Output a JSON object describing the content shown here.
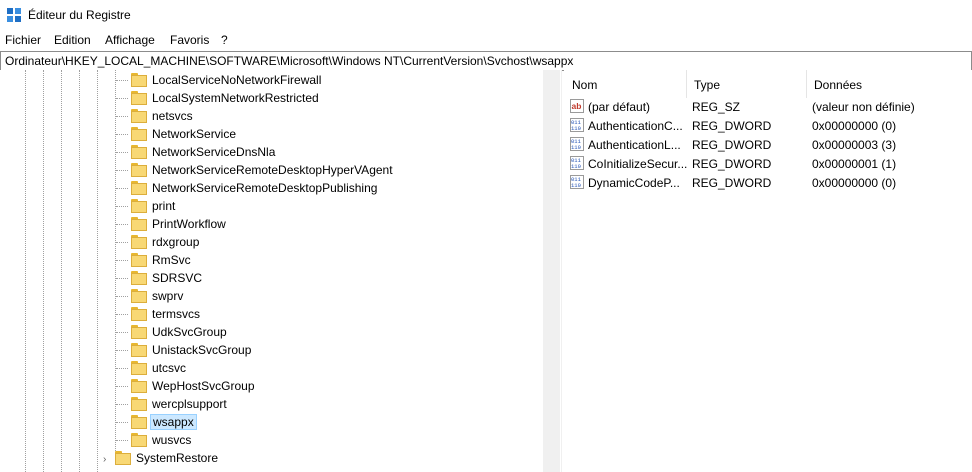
{
  "window": {
    "title": "Éditeur du Registre"
  },
  "menu": [
    "Fichier",
    "Edition",
    "Affichage",
    "Favoris",
    "?"
  ],
  "address": "Ordinateur\\HKEY_LOCAL_MACHINE\\SOFTWARE\\Microsoft\\Windows NT\\CurrentVersion\\Svchost\\wsappx",
  "tree": {
    "items": [
      {
        "label": "LocalServiceNoNetworkFirewall"
      },
      {
        "label": "LocalSystemNetworkRestricted"
      },
      {
        "label": "netsvcs"
      },
      {
        "label": "NetworkService"
      },
      {
        "label": "NetworkServiceDnsNla"
      },
      {
        "label": "NetworkServiceRemoteDesktopHyperVAgent"
      },
      {
        "label": "NetworkServiceRemoteDesktopPublishing"
      },
      {
        "label": "print"
      },
      {
        "label": "PrintWorkflow"
      },
      {
        "label": "rdxgroup"
      },
      {
        "label": "RmSvc"
      },
      {
        "label": "SDRSVC"
      },
      {
        "label": "swprv"
      },
      {
        "label": "termsvcs"
      },
      {
        "label": "UdkSvcGroup"
      },
      {
        "label": "UnistackSvcGroup"
      },
      {
        "label": "utcsvc"
      },
      {
        "label": "WepHostSvcGroup"
      },
      {
        "label": "wercplsupport"
      },
      {
        "label": "wsappx",
        "selected": true
      },
      {
        "label": "wusvcs"
      }
    ],
    "parent_item": {
      "label": "SystemRestore",
      "expander": "›"
    }
  },
  "values": {
    "headers": {
      "name": "Nom",
      "type": "Type",
      "data": "Données"
    },
    "rows": [
      {
        "icon": "string-value-icon",
        "name": "(par défaut)",
        "type": "REG_SZ",
        "data": "(valeur non définie)"
      },
      {
        "icon": "dword-value-icon",
        "name": "AuthenticationC...",
        "type": "REG_DWORD",
        "data": "0x00000000 (0)"
      },
      {
        "icon": "dword-value-icon",
        "name": "AuthenticationL...",
        "type": "REG_DWORD",
        "data": "0x00000003 (3)"
      },
      {
        "icon": "dword-value-icon",
        "name": "CoInitializeSecur...",
        "type": "REG_DWORD",
        "data": "0x00000001 (1)"
      },
      {
        "icon": "dword-value-icon",
        "name": "DynamicCodeP...",
        "type": "REG_DWORD",
        "data": "0x00000000 (0)"
      }
    ]
  }
}
